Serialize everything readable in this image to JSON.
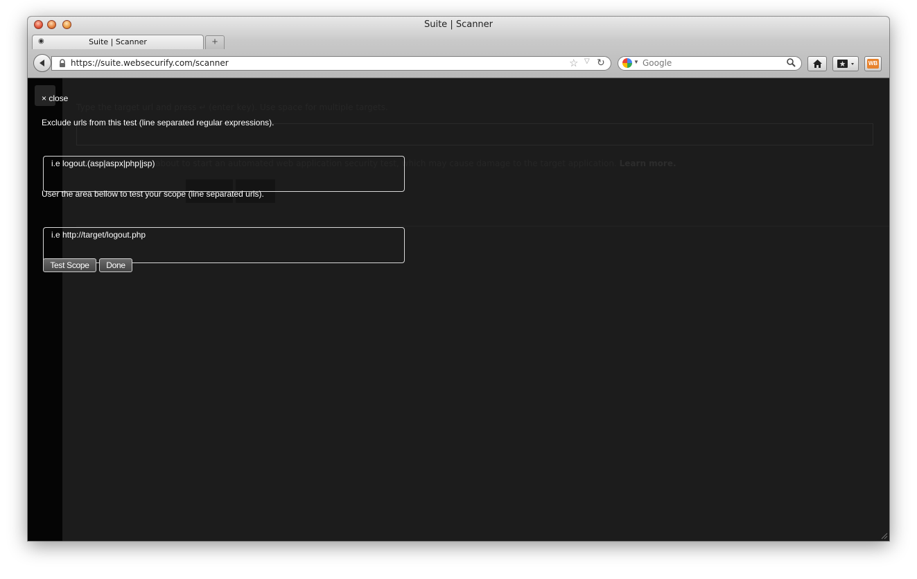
{
  "window": {
    "title": "Suite | Scanner"
  },
  "tab": {
    "label": "Suite | Scanner",
    "new_tab_glyph": "+"
  },
  "toolbar": {
    "url": "https://suite.websecurify.com/scanner",
    "search_placeholder": "Google",
    "addon_label": "WB"
  },
  "background": {
    "hint": "Type the target url and press ↵ (enter key). Use space for multiple targets.",
    "warning": "WARNING: You are about to start an automated web application security test, which may cause damage to the target application.",
    "learn_more": "Learn more."
  },
  "dialog": {
    "close_label": "× close",
    "exclude_label": "Exclude urls from this test (line separated regular expressions).",
    "exclude_placeholder": "i.e logout.(asp|aspx|php|jsp)",
    "scope_label": "User the area bellow to test your scope (line separated urls).",
    "scope_placeholder": "i.e http://target/logout.php",
    "test_scope_button": "Test Scope",
    "done_button": "Done"
  },
  "icons": [
    "back-arrow-icon",
    "lock-icon",
    "star-icon",
    "reload-icon",
    "google-icon",
    "search-icon",
    "home-icon",
    "bookmarks-icon",
    "websecurify-addon-icon",
    "resize-grip-icon"
  ]
}
